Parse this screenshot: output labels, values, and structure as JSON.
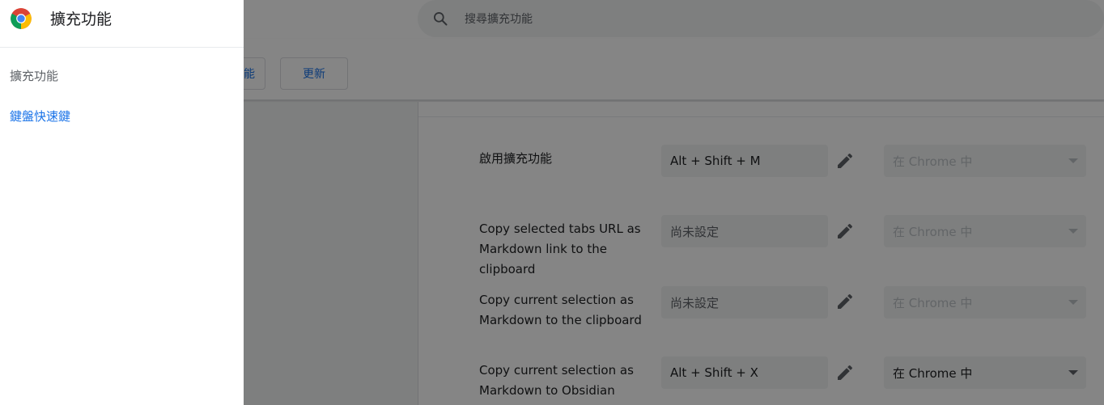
{
  "drawer": {
    "title": "擴充功能",
    "items": [
      {
        "label": "擴充功能"
      },
      {
        "label": "鍵盤快速鍵"
      }
    ]
  },
  "search": {
    "placeholder": "搜尋擴充功能"
  },
  "toolbar": {
    "pack_label": "封裝擴充功能",
    "pack_visible_tail": "能",
    "update_label": "更新"
  },
  "shortcuts": [
    {
      "label": "啟用擴充功能",
      "shortcut": "Alt  +  Shift  +  M",
      "scope": "在 Chrome 中",
      "scope_enabled": false
    },
    {
      "label": "Copy selected tabs URL as\nMarkdown link to the clipboard",
      "shortcut": "尚未設定",
      "scope": "在 Chrome 中",
      "scope_enabled": false
    },
    {
      "label": "Copy current selection as\nMarkdown to the clipboard",
      "shortcut": "尚未設定",
      "scope": "在 Chrome 中",
      "scope_enabled": false
    },
    {
      "label": "Copy current selection as\nMarkdown to Obsidian",
      "shortcut": "Alt  +  Shift  +  X",
      "scope": "在 Chrome 中",
      "scope_enabled": true
    }
  ],
  "colors": {
    "accent": "#1a73e8",
    "scrim": "rgba(0,0,0,0.48)"
  }
}
